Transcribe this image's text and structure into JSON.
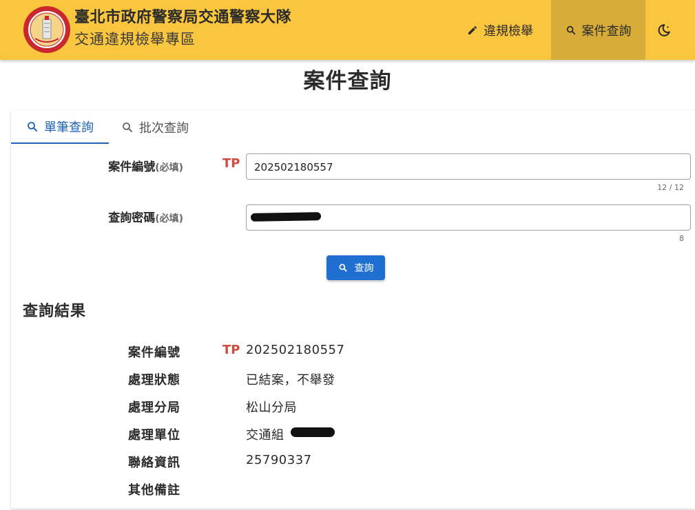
{
  "header": {
    "title": "臺北市政府警察局交通警察大隊",
    "subtitle": "交通違規檢舉專區",
    "nav": {
      "report_label": "違規檢舉",
      "query_label": "案件查詢"
    },
    "colors": {
      "bar": "#fbc63f",
      "active": "#d8ac38"
    },
    "icons": {
      "report": "pencil-icon",
      "query": "search-icon",
      "theme": "moon-star-icon"
    }
  },
  "page": {
    "title": "案件查詢"
  },
  "tabs": [
    {
      "label": "單筆查詢",
      "active": true
    },
    {
      "label": "批次查詢",
      "active": false
    }
  ],
  "form": {
    "case_number": {
      "label": "案件編號",
      "required": "(必填)",
      "prefix": "TP",
      "value": "202502180557",
      "counter": "12 / 12"
    },
    "password": {
      "label": "查詢密碼",
      "required": "(必填)",
      "counter": "8"
    },
    "submit_label": "查詢"
  },
  "results": {
    "title": "查詢結果",
    "rows": [
      {
        "label": "案件編號",
        "prefix": "TP",
        "value": "202502180557"
      },
      {
        "label": "處理狀態",
        "value": "已結案，不舉發"
      },
      {
        "label": "處理分局",
        "value": "松山分局"
      },
      {
        "label": "處理單位",
        "value": "交通組"
      },
      {
        "label": "聯絡資訊",
        "value": "25790337"
      },
      {
        "label": "其他備註",
        "value": ""
      }
    ]
  },
  "colors": {
    "accent": "#1e6fcf",
    "tp_red": "#d14b3e",
    "tab_active": "#1e63b0"
  }
}
